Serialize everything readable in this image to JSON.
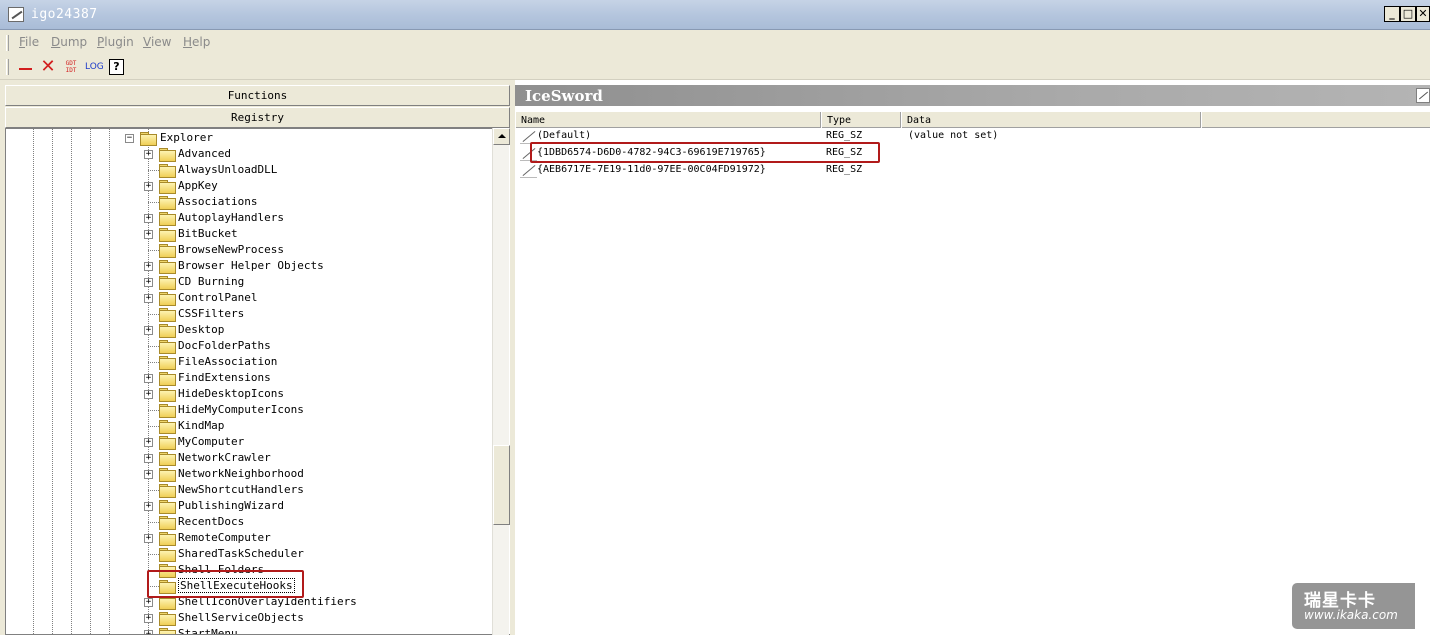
{
  "window": {
    "title": "igo24387",
    "min_label": "_",
    "max_label": "□",
    "close_label": "✕"
  },
  "menu": {
    "items": [
      "File",
      "Dump",
      "Plugin",
      "View",
      "Help"
    ]
  },
  "toolbar": {
    "gdt_label_top": "GDT",
    "gdt_label_bottom": "IDT",
    "log_label": "LOG",
    "help_label": "?"
  },
  "left_pane": {
    "functions_label": "Functions",
    "registry_label": "Registry",
    "tree": {
      "root": {
        "label": "Explorer",
        "expander": "−"
      },
      "children": [
        {
          "label": "Advanced",
          "expander": "+"
        },
        {
          "label": "AlwaysUnloadDLL",
          "expander": ""
        },
        {
          "label": "AppKey",
          "expander": "+"
        },
        {
          "label": "Associations",
          "expander": ""
        },
        {
          "label": "AutoplayHandlers",
          "expander": "+"
        },
        {
          "label": "BitBucket",
          "expander": "+"
        },
        {
          "label": "BrowseNewProcess",
          "expander": ""
        },
        {
          "label": "Browser Helper Objects",
          "expander": "+"
        },
        {
          "label": "CD Burning",
          "expander": "+"
        },
        {
          "label": "ControlPanel",
          "expander": "+"
        },
        {
          "label": "CSSFilters",
          "expander": ""
        },
        {
          "label": "Desktop",
          "expander": "+"
        },
        {
          "label": "DocFolderPaths",
          "expander": ""
        },
        {
          "label": "FileAssociation",
          "expander": ""
        },
        {
          "label": "FindExtensions",
          "expander": "+"
        },
        {
          "label": "HideDesktopIcons",
          "expander": "+"
        },
        {
          "label": "HideMyComputerIcons",
          "expander": ""
        },
        {
          "label": "KindMap",
          "expander": ""
        },
        {
          "label": "MyComputer",
          "expander": "+"
        },
        {
          "label": "NetworkCrawler",
          "expander": "+"
        },
        {
          "label": "NetworkNeighborhood",
          "expander": "+"
        },
        {
          "label": "NewShortcutHandlers",
          "expander": ""
        },
        {
          "label": "PublishingWizard",
          "expander": "+"
        },
        {
          "label": "RecentDocs",
          "expander": ""
        },
        {
          "label": "RemoteComputer",
          "expander": "+"
        },
        {
          "label": "SharedTaskScheduler",
          "expander": ""
        },
        {
          "label": "Shell Folders",
          "expander": ""
        },
        {
          "label": "ShellExecuteHooks",
          "expander": "",
          "selected": true
        },
        {
          "label": "ShellIconOverlayIdentifiers",
          "expander": "+"
        },
        {
          "label": "ShellServiceObjects",
          "expander": "+"
        },
        {
          "label": "StartMenu",
          "expander": "+"
        }
      ]
    }
  },
  "right_pane": {
    "header_title": "IceSword",
    "columns": [
      "Name",
      "Type",
      "Data"
    ],
    "rows": [
      {
        "name": "(Default)",
        "type": "REG_SZ",
        "data": "(value not set)"
      },
      {
        "name": "{1DBD6574-D6D0-4782-94C3-69619E719765}",
        "type": "REG_SZ",
        "data": ""
      },
      {
        "name": "{AEB6717E-7E19-11d0-97EE-00C04FD91972}",
        "type": "REG_SZ",
        "data": ""
      }
    ]
  },
  "watermark": {
    "brand": "瑞星卡卡",
    "url": "www.ikaka.com"
  },
  "colors": {
    "highlight": "#b11a1a",
    "toolbar_red": "#d21e1e",
    "toolbar_blue": "#1e3cc8"
  }
}
